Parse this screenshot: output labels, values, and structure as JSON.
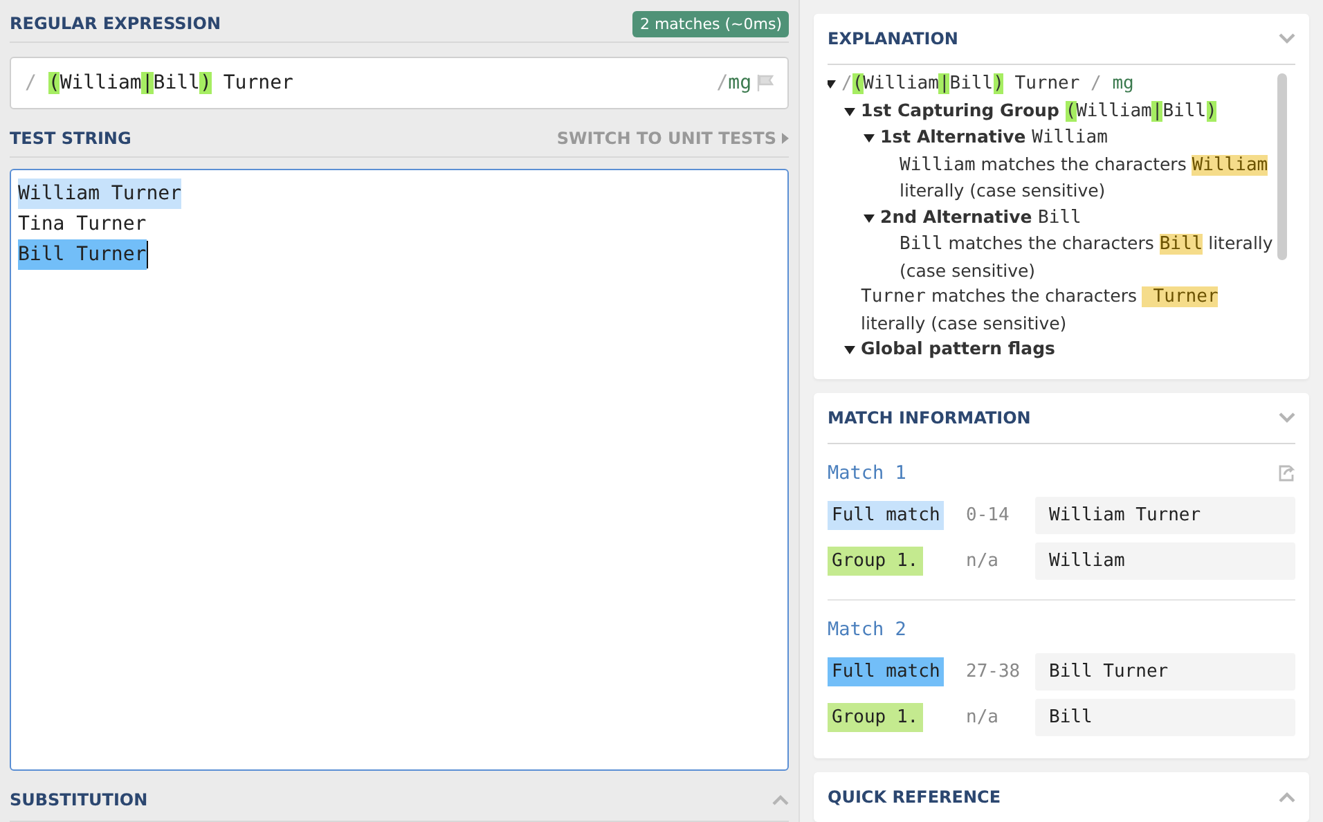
{
  "regex": {
    "title": "REGULAR EXPRESSION",
    "badge": "2 matches (~0ms)",
    "open_delimiter": "/",
    "tokens": [
      {
        "kind": "group",
        "text": "("
      },
      {
        "kind": "text",
        "text": "William"
      },
      {
        "kind": "group",
        "text": "|"
      },
      {
        "kind": "text",
        "text": "Bill"
      },
      {
        "kind": "group",
        "text": ")"
      },
      {
        "kind": "text",
        "text": " Turner"
      }
    ],
    "close_delimiter": "/",
    "flags": "mg"
  },
  "test_string": {
    "title": "TEST STRING",
    "switch_link": "SWITCH TO UNIT TESTS",
    "lines": [
      {
        "text": "William Turner",
        "color": "#c7e2fb"
      },
      {
        "text": "Tina Turner"
      },
      {
        "text": "Bill Turner",
        "color": "#72bef8"
      }
    ]
  },
  "substitution": {
    "title": "SUBSTITUTION",
    "expanded": false
  },
  "explanation": {
    "title": "EXPLANATION",
    "expanded": true,
    "tree": [
      {
        "expanded": true,
        "segments": [
          {
            "kind": "delim",
            "text": "/"
          },
          {
            "kind": "group",
            "text": "("
          },
          {
            "kind": "code",
            "text": "William"
          },
          {
            "kind": "group",
            "text": "|"
          },
          {
            "kind": "code",
            "text": "Bill"
          },
          {
            "kind": "group",
            "text": ")"
          },
          {
            "kind": "code",
            "text": " Turner "
          },
          {
            "kind": "delim",
            "text": "/"
          },
          {
            "kind": "flag",
            "text": " mg"
          }
        ],
        "children": [
          {
            "expanded": true,
            "segments": [
              {
                "kind": "bold",
                "text": "1st Capturing Group "
              },
              {
                "kind": "group",
                "text": "("
              },
              {
                "kind": "code",
                "text": "William"
              },
              {
                "kind": "group",
                "text": "|"
              },
              {
                "kind": "code",
                "text": "Bill"
              },
              {
                "kind": "group",
                "text": ")"
              }
            ],
            "children": [
              {
                "expanded": true,
                "segments": [
                  {
                    "kind": "bold",
                    "text": "1st Alternative "
                  },
                  {
                    "kind": "code",
                    "text": "William"
                  }
                ],
                "children": [
                  {
                    "segments": [
                      {
                        "kind": "code",
                        "text": "William"
                      },
                      {
                        "kind": "text",
                        "text": " matches the characters "
                      },
                      {
                        "kind": "match",
                        "text": "William"
                      },
                      {
                        "kind": "text",
                        "text": " literally (case sensitive)"
                      }
                    ]
                  }
                ]
              },
              {
                "expanded": true,
                "segments": [
                  {
                    "kind": "bold",
                    "text": "2nd Alternative "
                  },
                  {
                    "kind": "code",
                    "text": "Bill"
                  }
                ],
                "children": [
                  {
                    "segments": [
                      {
                        "kind": "code",
                        "text": "Bill"
                      },
                      {
                        "kind": "text",
                        "text": " matches the characters "
                      },
                      {
                        "kind": "match",
                        "text": "Bill"
                      },
                      {
                        "kind": "text",
                        "text": " literally (case sensitive)"
                      }
                    ]
                  }
                ]
              }
            ]
          },
          {
            "segments": [
              {
                "kind": "code",
                "text": "Turner"
              },
              {
                "kind": "text",
                "text": " matches the characters "
              },
              {
                "kind": "match",
                "text": " Turner"
              },
              {
                "kind": "text",
                "text": " literally (case sensitive)"
              }
            ]
          },
          {
            "expanded": true,
            "segments": [
              {
                "kind": "bold",
                "text": "Global pattern flags"
              }
            ]
          }
        ]
      }
    ]
  },
  "match_information": {
    "title": "MATCH INFORMATION",
    "expanded": true,
    "matches": [
      {
        "title": "Match 1",
        "rows": [
          {
            "label": "Full match",
            "color": "#c7e2fb",
            "range": "0-14",
            "value": "William Turner"
          },
          {
            "label": "Group 1.",
            "color": "#c4ea8f",
            "range": "n/a",
            "value": "William"
          }
        ]
      },
      {
        "title": "Match 2",
        "rows": [
          {
            "label": "Full match",
            "color": "#72bef8",
            "range": "27-38",
            "value": "Bill Turner"
          },
          {
            "label": "Group 1.",
            "color": "#c4ea8f",
            "range": "n/a",
            "value": "Bill"
          }
        ]
      }
    ]
  },
  "quick_reference": {
    "title": "QUICK REFERENCE",
    "expanded": false
  }
}
